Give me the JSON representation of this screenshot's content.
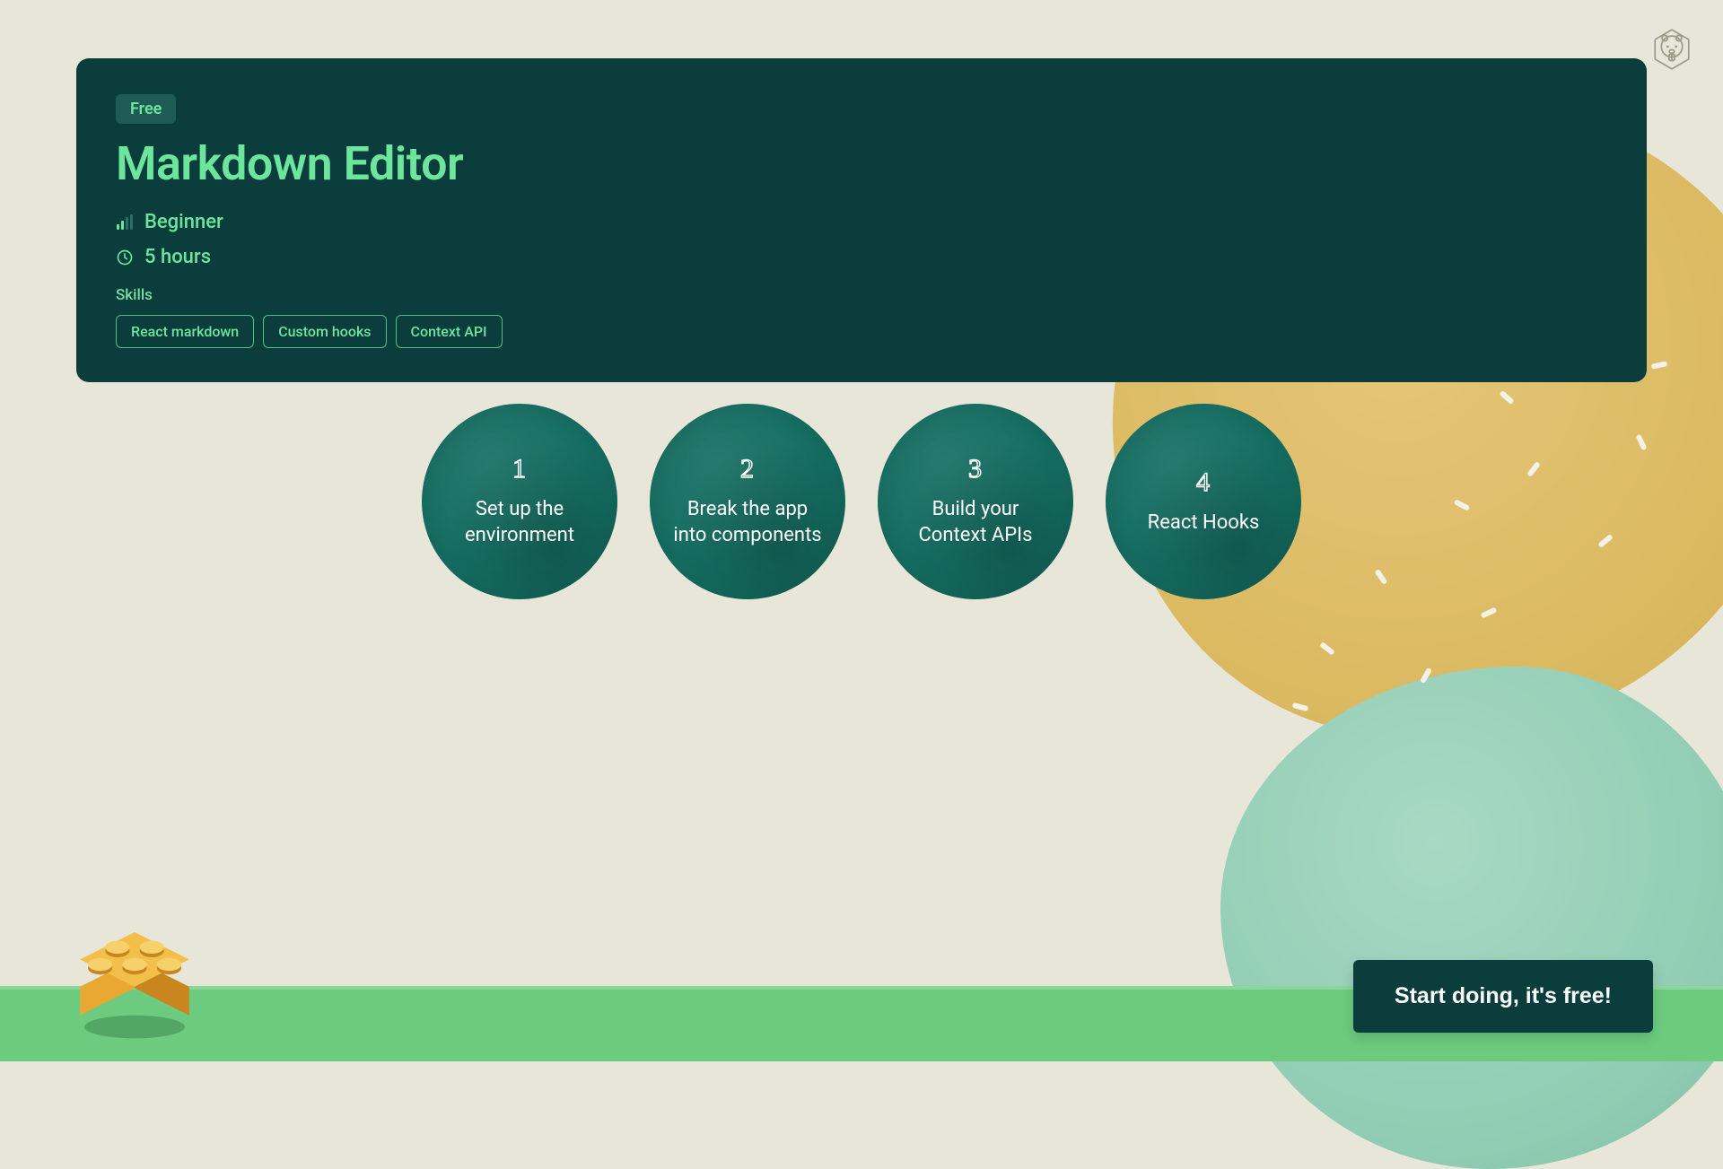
{
  "hero": {
    "badge": "Free",
    "title": "Markdown Editor",
    "level": "Beginner",
    "duration": "5 hours",
    "skills_label": "Skills",
    "skills": [
      "React markdown",
      "Custom hooks",
      "Context API"
    ]
  },
  "steps": [
    {
      "num": "1",
      "text": "Set up the environment"
    },
    {
      "num": "2",
      "text": "Break the app into components"
    },
    {
      "num": "3",
      "text": "Build your Context APIs"
    },
    {
      "num": "4",
      "text": "React Hooks"
    }
  ],
  "cta": {
    "label": "Start doing, it's free!"
  },
  "colors": {
    "accent": "#6DE59D",
    "card_bg": "#0A3D3C",
    "page_bg": "#E8E6D9",
    "footer_bg": "#6DCB7F",
    "step_bg": "#156E62"
  }
}
